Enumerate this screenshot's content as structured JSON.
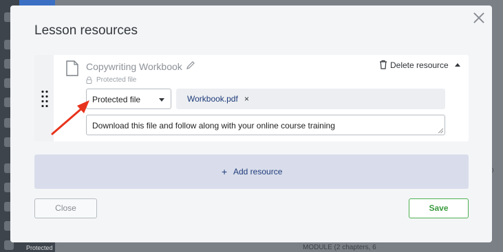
{
  "background": {
    "sidebar_badge": "Protected",
    "module_text": "MODULE (2 chapters, 6",
    "partial_char": "p"
  },
  "modal": {
    "title": "Lesson resources",
    "close_icon": "close-icon"
  },
  "resource": {
    "title": "Copywriting Workbook",
    "subtitle": "Protected file",
    "delete_label": "Delete resource",
    "type_selected": "Protected file",
    "file_name": "Workbook.pdf",
    "file_remove": "×",
    "description": "Download this file and follow along with your online course training"
  },
  "add_resource": {
    "plus": "+",
    "label": "Add resource"
  },
  "footer": {
    "close_label": "Close",
    "save_label": "Save"
  },
  "colors": {
    "annotation_arrow": "#e8331c",
    "save_green": "#4caf50",
    "link_blue": "#1f3b7a",
    "add_bg": "#d9ddeb"
  }
}
